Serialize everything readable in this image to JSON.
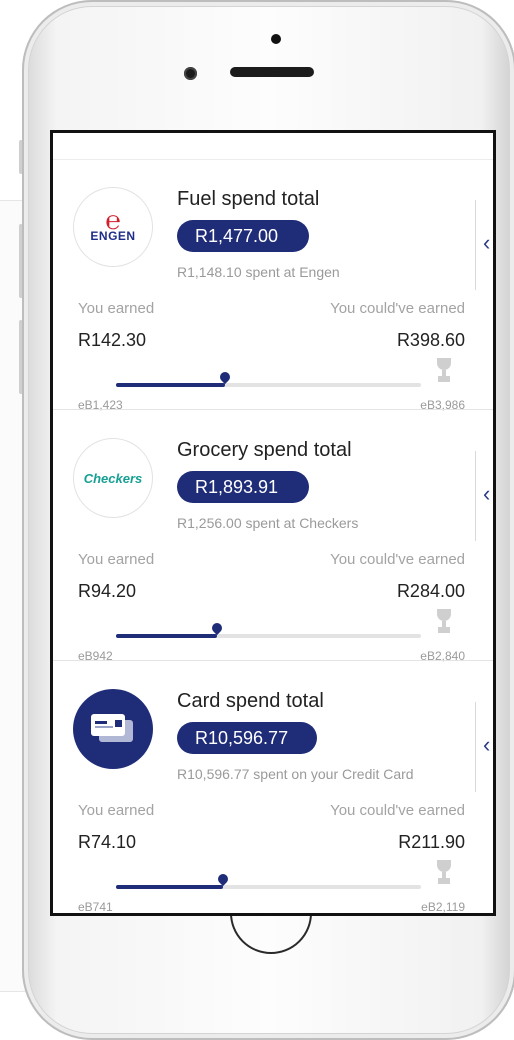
{
  "cards": [
    {
      "logo": "engen-logo",
      "logo_text": "ENGEN",
      "title": "Fuel spend total",
      "total": "R1,477.00",
      "spent": "R1,148.10 spent at Engen",
      "earned_label": "You earned",
      "could_label": "You could've earned",
      "earned_value": "R142.30",
      "could_value": "R398.60",
      "eb_earned": "eB1,423",
      "eb_max": "eB3,986",
      "progress": 0.357
    },
    {
      "logo": "checkers-logo",
      "logo_text": "Checkers",
      "title": "Grocery spend total",
      "total": "R1,893.91",
      "spent": "R1,256.00 spent at Checkers",
      "earned_label": "You earned",
      "could_label": "You could've earned",
      "earned_value": "R94.20",
      "could_value": "R284.00",
      "eb_earned": "eB942",
      "eb_max": "eB2,840",
      "progress": 0.332
    },
    {
      "logo": "credit-card-icon",
      "logo_text": "",
      "title": "Card spend total",
      "total": "R10,596.77",
      "spent": "R10,596.77 spent on your Credit Card",
      "earned_label": "You earned",
      "could_label": "You could've earned",
      "earned_value": "R74.10",
      "could_value": "R211.90",
      "eb_earned": "eB741",
      "eb_max": "eB2,119",
      "progress": 0.35
    }
  ],
  "colors": {
    "brand_navy": "#1f2d78",
    "engen_red": "#d11f2b",
    "checkers_teal": "#17a094"
  },
  "icons": {
    "chevron": "chevron-left-icon",
    "trophy": "trophy-icon",
    "marker": "location-pin-icon"
  }
}
